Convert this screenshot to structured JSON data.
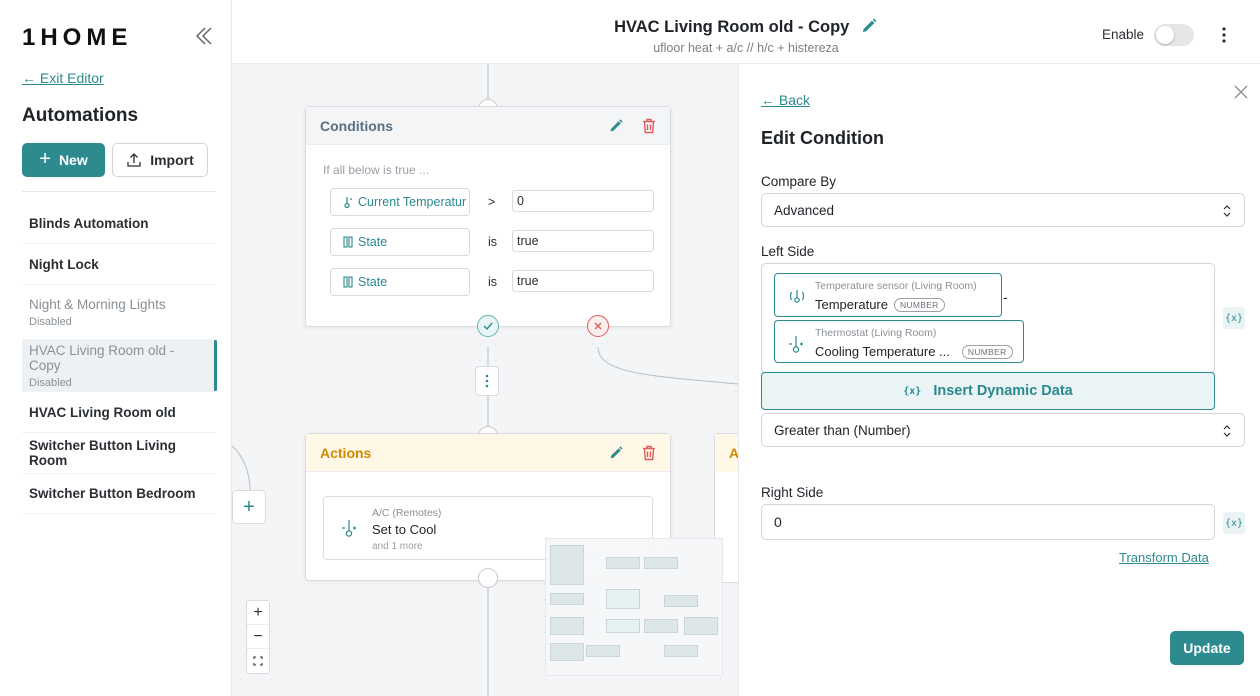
{
  "sidebar": {
    "logo": "1HOME",
    "exit_label": "← Exit Editor",
    "title": "Automations",
    "new_label": "New",
    "import_label": "Import",
    "items": [
      {
        "name": "Blinds Automation",
        "status": ""
      },
      {
        "name": "Night Lock",
        "status": ""
      },
      {
        "name": "Night & Morning Lights",
        "status": "Disabled"
      },
      {
        "name": "HVAC Living Room old - Copy",
        "status": "Disabled"
      },
      {
        "name": "HVAC Living Room old",
        "status": ""
      },
      {
        "name": "Switcher Button Living Room",
        "status": ""
      },
      {
        "name": "Switcher Button Bedroom",
        "status": ""
      }
    ]
  },
  "header": {
    "title": "HVAC Living Room old - Copy",
    "subtitle": "ufloor heat + a/c // h/c + histereza",
    "enable_label": "Enable"
  },
  "canvas": {
    "conditions_node": {
      "title": "Conditions",
      "intro": "If all below is true ...",
      "rows": [
        {
          "left": "Current Temperatur",
          "op": ">",
          "value": "0"
        },
        {
          "left": "State",
          "op": "is",
          "value": "true"
        },
        {
          "left": "State",
          "op": "is",
          "value": "true"
        }
      ]
    },
    "actions_node": {
      "title": "Actions",
      "card_category": "A/C (Remotes)",
      "card_name": "Set to Cool",
      "card_more": "and 1 more"
    },
    "partial_node_title": "A",
    "zoom_in": "+",
    "zoom_out": "−"
  },
  "panel": {
    "back_label": "← Back",
    "title": "Edit Condition",
    "compare_label": "Compare By",
    "compare_value": "Advanced",
    "left_label": "Left Side",
    "chip1_device": "Temperature sensor (Living Room)",
    "chip1_name": "Temperature",
    "chip1_type": "NUMBER",
    "minus": "-",
    "chip2_device": "Thermostat (Living Room)",
    "chip2_name": "Cooling Temperature ...",
    "chip2_type": "NUMBER",
    "insert_label": "Insert Dynamic Data",
    "operator_value": "Greater than (Number)",
    "right_label": "Right Side",
    "right_value": "0",
    "transform_label": "Transform Data",
    "update_label": "Update",
    "var_icon": "{x}"
  },
  "colors": {
    "accent": "#2d8a8f",
    "action_header": "#d08a00",
    "delete": "#e05a5a"
  }
}
